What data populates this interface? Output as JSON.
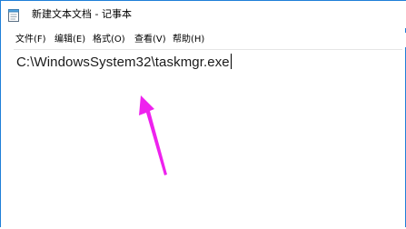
{
  "window": {
    "title": "新建文本文档 - 记事本"
  },
  "menu": {
    "file": "文件(F)",
    "edit": "编辑(E)",
    "format": "格式(O)",
    "view": "查看(V)",
    "help": "帮助(H)"
  },
  "editor": {
    "content": "C:\\WindowsSystem32\\taskmgr.exe"
  },
  "colors": {
    "accent_border": "#1f7fd8",
    "arrow": "#ee22ee"
  },
  "icons": {
    "app": "notepad-icon",
    "annotation": "arrow-pointer-icon"
  }
}
